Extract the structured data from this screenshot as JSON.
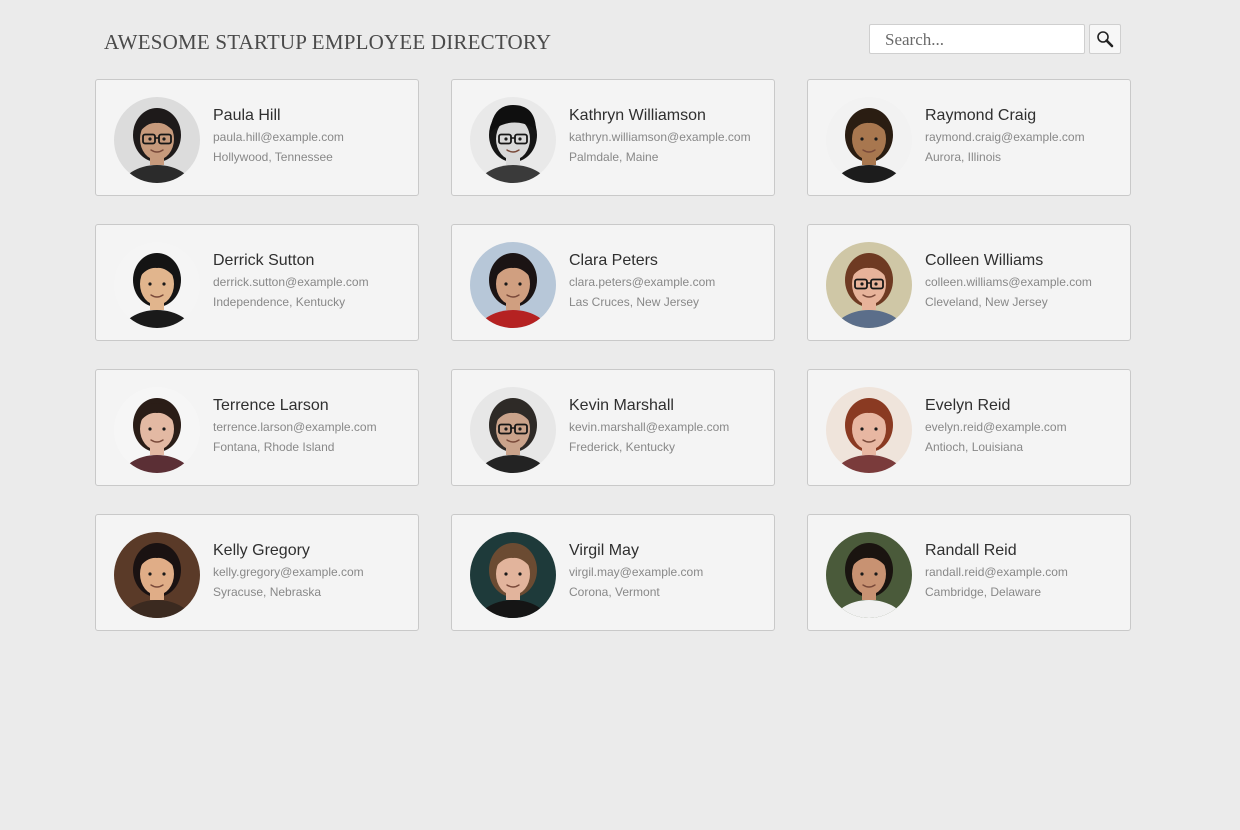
{
  "header": {
    "title": "AWESOME STARTUP EMPLOYEE DIRECTORY"
  },
  "search": {
    "placeholder": "Search...",
    "value": "",
    "button_icon": "magnifier-icon"
  },
  "employees": [
    {
      "name": "Paula Hill",
      "email": "paula.hill@example.com",
      "location": "Hollywood, Tennessee",
      "avatar": {
        "bg": "#dcdcdc",
        "skin": "#c79a7c",
        "hair": "#1e1a1a",
        "shirt": "#2b2b2b",
        "glasses": true,
        "hat": false
      }
    },
    {
      "name": "Kathryn Williamson",
      "email": "kathryn.williamson@example.com",
      "location": "Palmdale, Maine",
      "avatar": {
        "bg": "#e9e9e9",
        "skin": "#d9d9d9",
        "hair": "#151515",
        "shirt": "#3a3a3a",
        "glasses": true,
        "hat": true
      }
    },
    {
      "name": "Raymond Craig",
      "email": "raymond.craig@example.com",
      "location": "Aurora, Illinois",
      "avatar": {
        "bg": "#f2f2f2",
        "skin": "#a8774f",
        "hair": "#2a1d12",
        "shirt": "#1c1c1c",
        "glasses": false,
        "hat": false
      }
    },
    {
      "name": "Derrick Sutton",
      "email": "derrick.sutton@example.com",
      "location": "Independence, Kentucky",
      "avatar": {
        "bg": "#f5f5f5",
        "skin": "#e1b58d",
        "hair": "#141414",
        "shirt": "#1a1a1a",
        "glasses": false,
        "hat": false
      }
    },
    {
      "name": "Clara Peters",
      "email": "clara.peters@example.com",
      "location": "Las Cruces, New Jersey",
      "avatar": {
        "bg": "#b7c7d8",
        "skin": "#d09f80",
        "hair": "#1b1414",
        "shirt": "#b52222",
        "glasses": false,
        "hat": false
      }
    },
    {
      "name": "Colleen Williams",
      "email": "colleen.williams@example.com",
      "location": "Cleveland, New Jersey",
      "avatar": {
        "bg": "#cfc7a6",
        "skin": "#e7b39a",
        "hair": "#6e3a22",
        "shirt": "#5b6e8a",
        "glasses": true,
        "hat": false
      }
    },
    {
      "name": "Terrence Larson",
      "email": "terrence.larson@example.com",
      "location": "Fontana, Rhode Island",
      "avatar": {
        "bg": "#f6f6f6",
        "skin": "#e3b9a3",
        "hair": "#2a1d17",
        "shirt": "#5b2f35",
        "glasses": false,
        "hat": false
      }
    },
    {
      "name": "Kevin Marshall",
      "email": "kevin.marshall@example.com",
      "location": "Frederick, Kentucky",
      "avatar": {
        "bg": "#e7e7e7",
        "skin": "#caa38b",
        "hair": "#2e2a27",
        "shirt": "#232323",
        "glasses": true,
        "hat": false
      }
    },
    {
      "name": "Evelyn Reid",
      "email": "evelyn.reid@example.com",
      "location": "Antioch, Louisiana",
      "avatar": {
        "bg": "#efe4db",
        "skin": "#e8b7a2",
        "hair": "#8a3a22",
        "shirt": "#7a3b3b",
        "glasses": false,
        "hat": false
      }
    },
    {
      "name": "Kelly Gregory",
      "email": "kelly.gregory@example.com",
      "location": "Syracuse, Nebraska",
      "avatar": {
        "bg": "#5a3a28",
        "skin": "#e0ad87",
        "hair": "#1a1212",
        "shirt": "#3b2a20",
        "glasses": false,
        "hat": false
      }
    },
    {
      "name": "Virgil May",
      "email": "virgil.may@example.com",
      "location": "Corona, Vermont",
      "avatar": {
        "bg": "#1e3a3a",
        "skin": "#e2b49c",
        "hair": "#6b4b32",
        "shirt": "#151515",
        "glasses": false,
        "hat": false
      }
    },
    {
      "name": "Randall Reid",
      "email": "randall.reid@example.com",
      "location": "Cambridge, Delaware",
      "avatar": {
        "bg": "#4a5a3a",
        "skin": "#c89272",
        "hair": "#1a1410",
        "shirt": "#f1f1f1",
        "glasses": false,
        "hat": false
      }
    }
  ]
}
